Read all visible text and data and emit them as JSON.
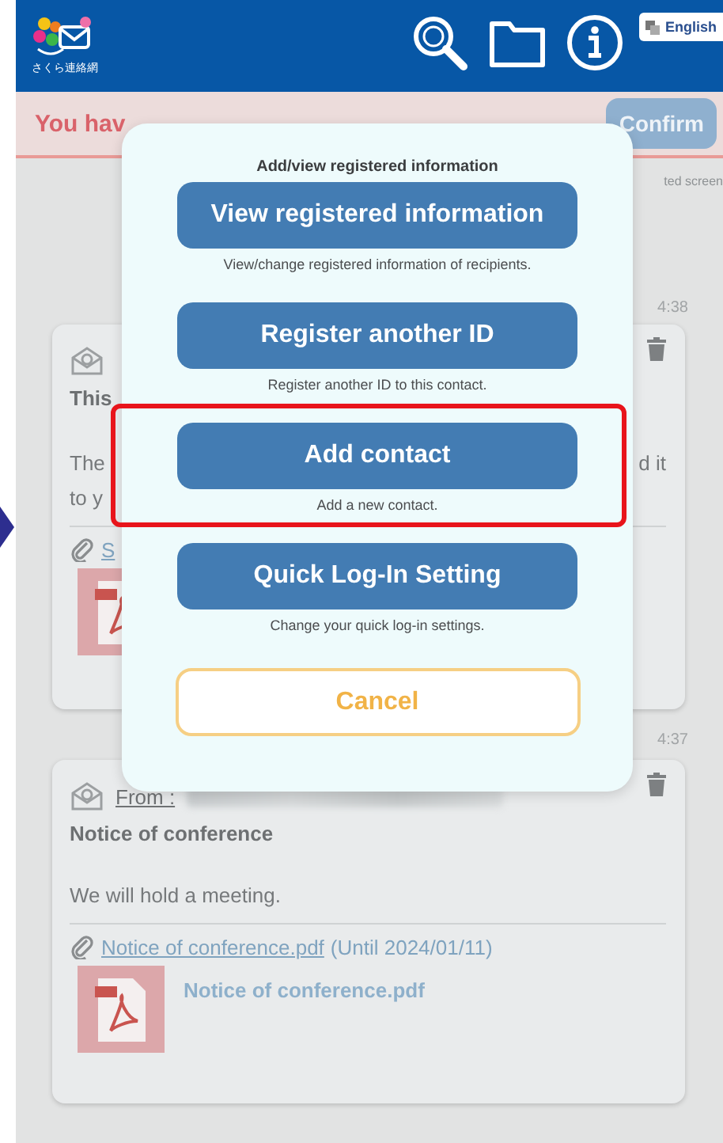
{
  "header": {
    "logo_text": "さくら連絡網",
    "language_button": "English"
  },
  "notice": {
    "text": "You hav",
    "button": "Confirm"
  },
  "hint_text": "ted screen",
  "messages": [
    {
      "time": "4:38",
      "subject": "This",
      "body_lines": [
        {
          "left": "The",
          "right": "d it"
        },
        {
          "left": "to y"
        }
      ],
      "attachment_link": "S"
    },
    {
      "time": "4:37",
      "from_label": "From :",
      "subject": "Notice of conference",
      "body_lines": [
        {
          "left": "We will hold a meeting."
        }
      ],
      "attachment_link": "Notice of conference.pdf",
      "attachment_until": "(Until 2024/01/11)",
      "file_name": "Notice of conference.pdf"
    }
  ],
  "modal": {
    "title": "Add/view registered information",
    "options": [
      {
        "label": "View registered information",
        "caption": "View/change registered information of recipients.",
        "highlighted": false
      },
      {
        "label": "Register another ID",
        "caption": "Register another ID to this contact.",
        "highlighted": false
      },
      {
        "label": "Add contact",
        "caption": "Add a new contact.",
        "highlighted": true
      },
      {
        "label": "Quick Log-In Setting",
        "caption": "Change your quick log-in settings.",
        "highlighted": false
      }
    ],
    "cancel": "Cancel"
  }
}
